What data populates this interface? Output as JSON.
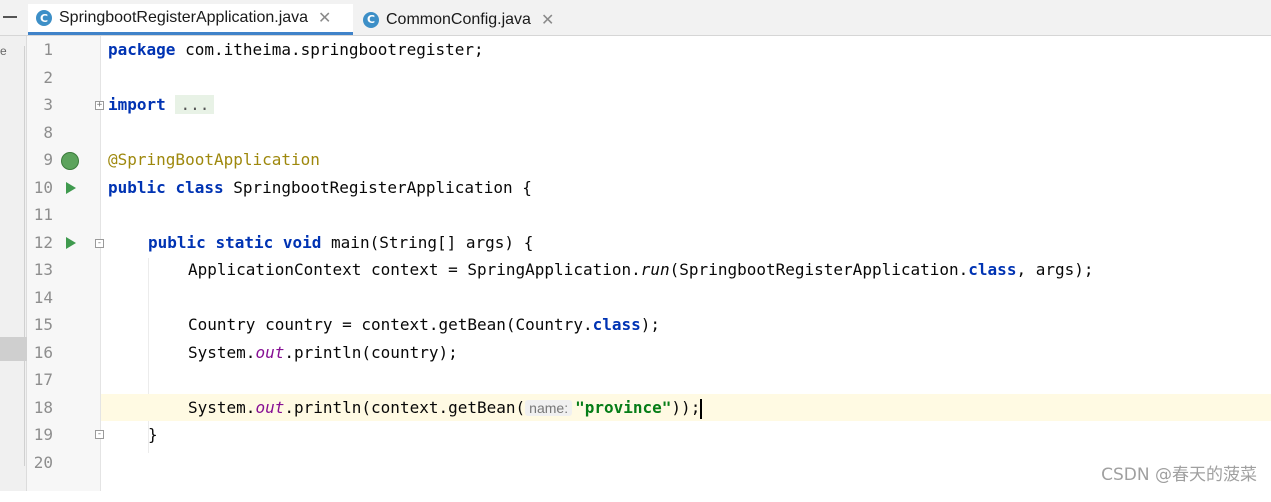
{
  "tabs": [
    {
      "label": "SpringbootRegisterApplication.java",
      "icon": "spring-class-icon",
      "active": true,
      "close": "✕"
    },
    {
      "label": "CommonConfig.java",
      "icon": "class-c-icon",
      "active": false,
      "close": "✕"
    }
  ],
  "left_strip": {
    "char": "e"
  },
  "lines": [
    {
      "num": "1"
    },
    {
      "num": "2"
    },
    {
      "num": "3"
    },
    {
      "num": "8"
    },
    {
      "num": "9"
    },
    {
      "num": "10"
    },
    {
      "num": "11"
    },
    {
      "num": "12"
    },
    {
      "num": "13"
    },
    {
      "num": "14"
    },
    {
      "num": "15"
    },
    {
      "num": "16"
    },
    {
      "num": "17"
    },
    {
      "num": "18"
    },
    {
      "num": "19"
    },
    {
      "num": "20"
    }
  ],
  "code": {
    "l1": {
      "kw": "package",
      "rest": " com.itheima.springbootregister;"
    },
    "l3": {
      "kw": "import",
      "dots": "..."
    },
    "l9": {
      "annotation": "@SpringBootApplication"
    },
    "l10": {
      "kw1": "public",
      "kw2": "class",
      "rest": " SpringbootRegisterApplication {"
    },
    "l12": {
      "kw1": "public",
      "kw2": "static",
      "kw3": "void",
      "rest": " main(String[] args) {"
    },
    "l13": {
      "a": "ApplicationContext context = SpringApplication.",
      "call": "run",
      "b": "(SpringbootRegisterApplication.",
      "kw": "class",
      "c": ", args);"
    },
    "l15": {
      "a": "Country country = context.getBean(Country.",
      "kw": "class",
      "c": ");"
    },
    "l16": {
      "a": "System.",
      "field": "out",
      "c": ".println(country);"
    },
    "l18": {
      "a": "System.",
      "field": "out",
      "b": ".println(context.getBean(",
      "hint": "name:",
      "str": "\"province\"",
      "c": "));"
    },
    "l19": {
      "brace": "}"
    }
  },
  "colors": {
    "keyword": "#0033b3",
    "annotation": "#9e880d",
    "string": "#067d17",
    "static_field": "#871094",
    "current_line": "#fffae3",
    "tab_underline": "#4083c9"
  },
  "watermark": "CSDN @春天的菠菜"
}
